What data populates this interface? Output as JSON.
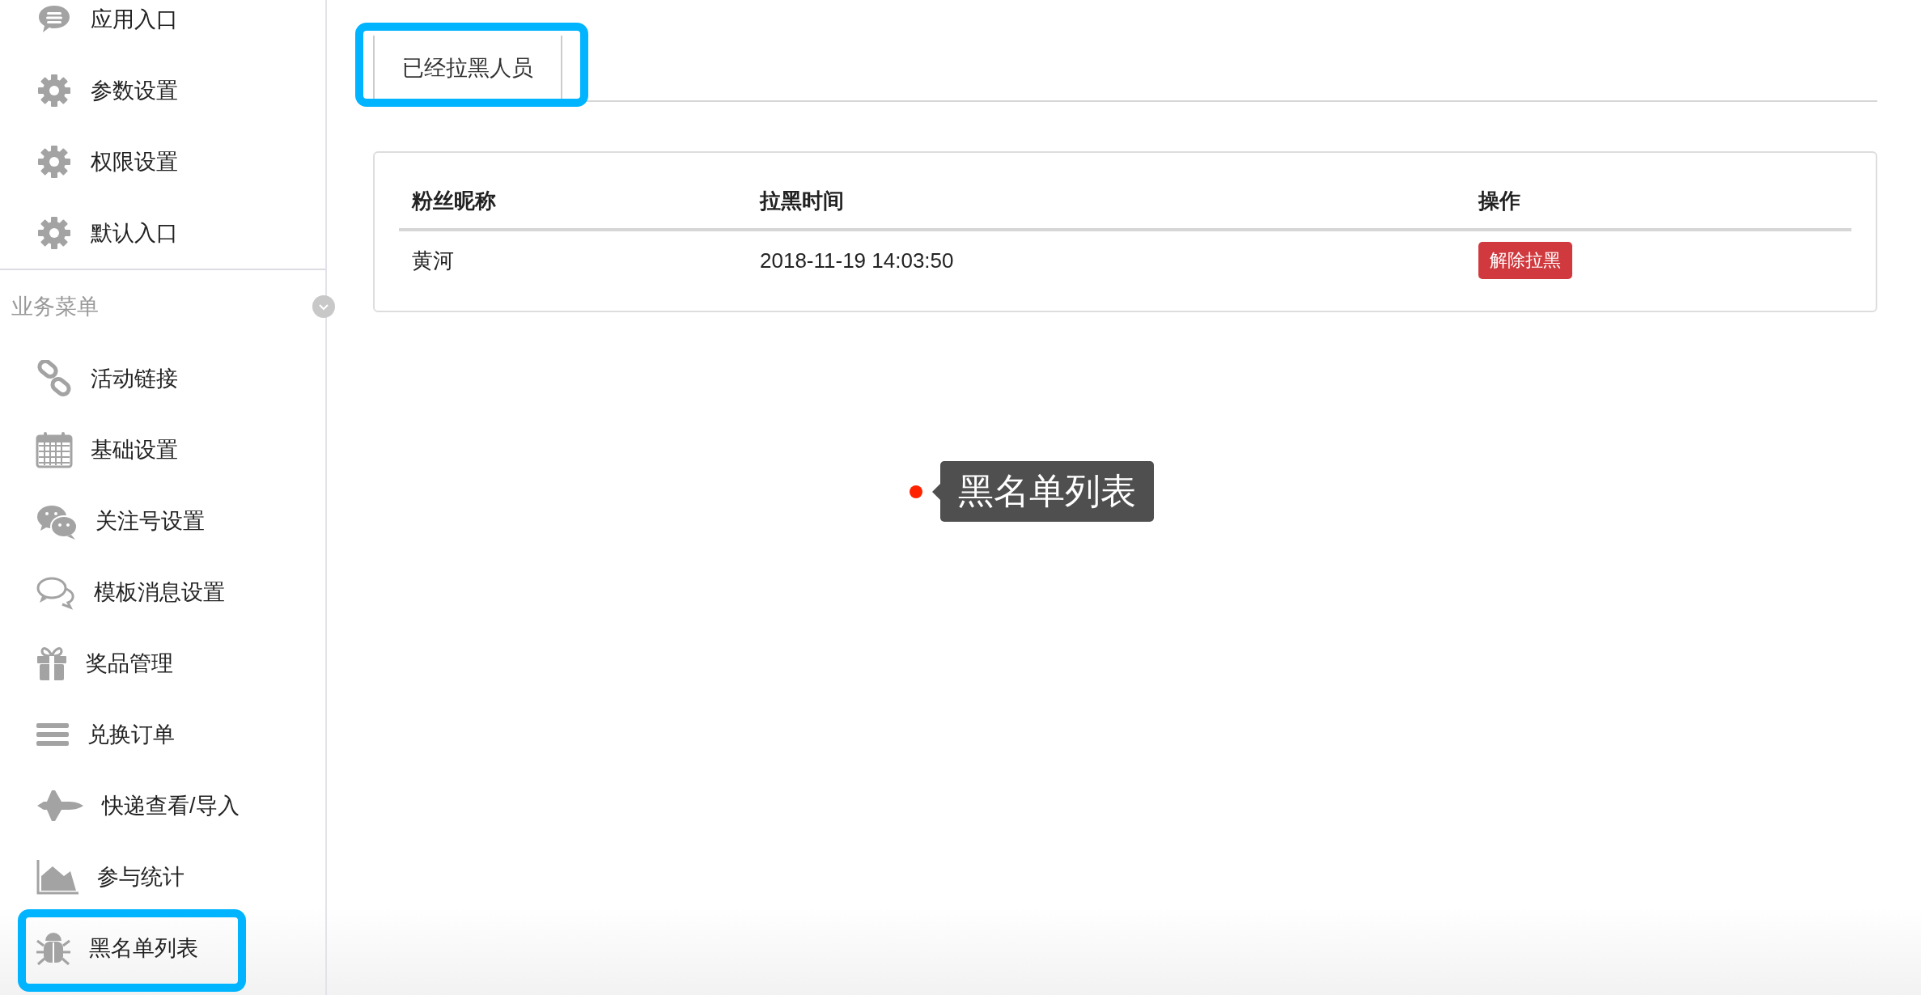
{
  "sidebar": {
    "top_items": [
      {
        "label": "应用入口",
        "kind": "chat",
        "highlighted": false
      },
      {
        "label": "参数设置",
        "kind": "gear",
        "highlighted": false
      },
      {
        "label": "权限设置",
        "kind": "gear",
        "highlighted": false
      },
      {
        "label": "默认入口",
        "kind": "gear",
        "highlighted": false
      }
    ],
    "section": {
      "title": "业务菜单",
      "expanded": true
    },
    "items": [
      {
        "label": "活动链接",
        "kind": "link",
        "highlighted": false
      },
      {
        "label": "基础设置",
        "kind": "calendar",
        "highlighted": false
      },
      {
        "label": "关注号设置",
        "kind": "wechat",
        "highlighted": false
      },
      {
        "label": "模板消息设置",
        "kind": "bubbles",
        "highlighted": false
      },
      {
        "label": "奖品管理",
        "kind": "gift",
        "highlighted": false
      },
      {
        "label": "兑换订单",
        "kind": "lines",
        "highlighted": false
      },
      {
        "label": "快递查看/导入",
        "kind": "shuttle",
        "highlighted": false
      },
      {
        "label": "参与统计",
        "kind": "area",
        "highlighted": false
      },
      {
        "label": "黑名单列表",
        "kind": "bug",
        "highlighted": true
      }
    ]
  },
  "tabs": [
    {
      "label": "已经拉黑人员",
      "selected": true,
      "highlighted": true
    }
  ],
  "table": {
    "columns": [
      "粉丝昵称",
      "拉黑时间",
      "操作"
    ],
    "rows": [
      {
        "name": "黄河",
        "time": "2018-11-19 14:03:50",
        "action": "解除拉黑"
      }
    ]
  },
  "tooltip": {
    "text": "黑名单列表"
  }
}
